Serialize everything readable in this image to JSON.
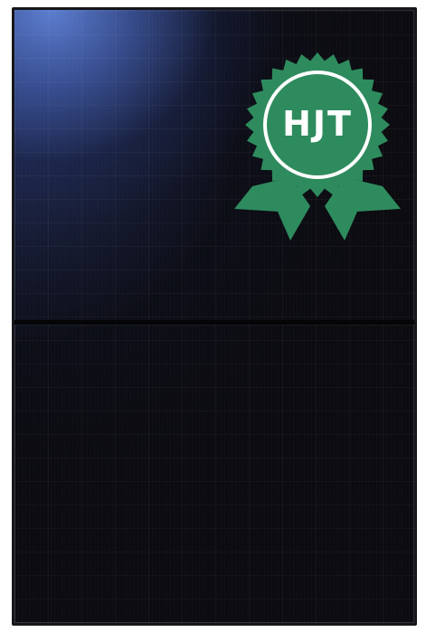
{
  "badge": {
    "label": "HJT",
    "color": "#2e8b5e",
    "ring_color": "#ffffff"
  },
  "panel": {
    "frame_color": "#17171b",
    "cell_color": "#0b0b10",
    "glare_color": "#5f82d7"
  }
}
